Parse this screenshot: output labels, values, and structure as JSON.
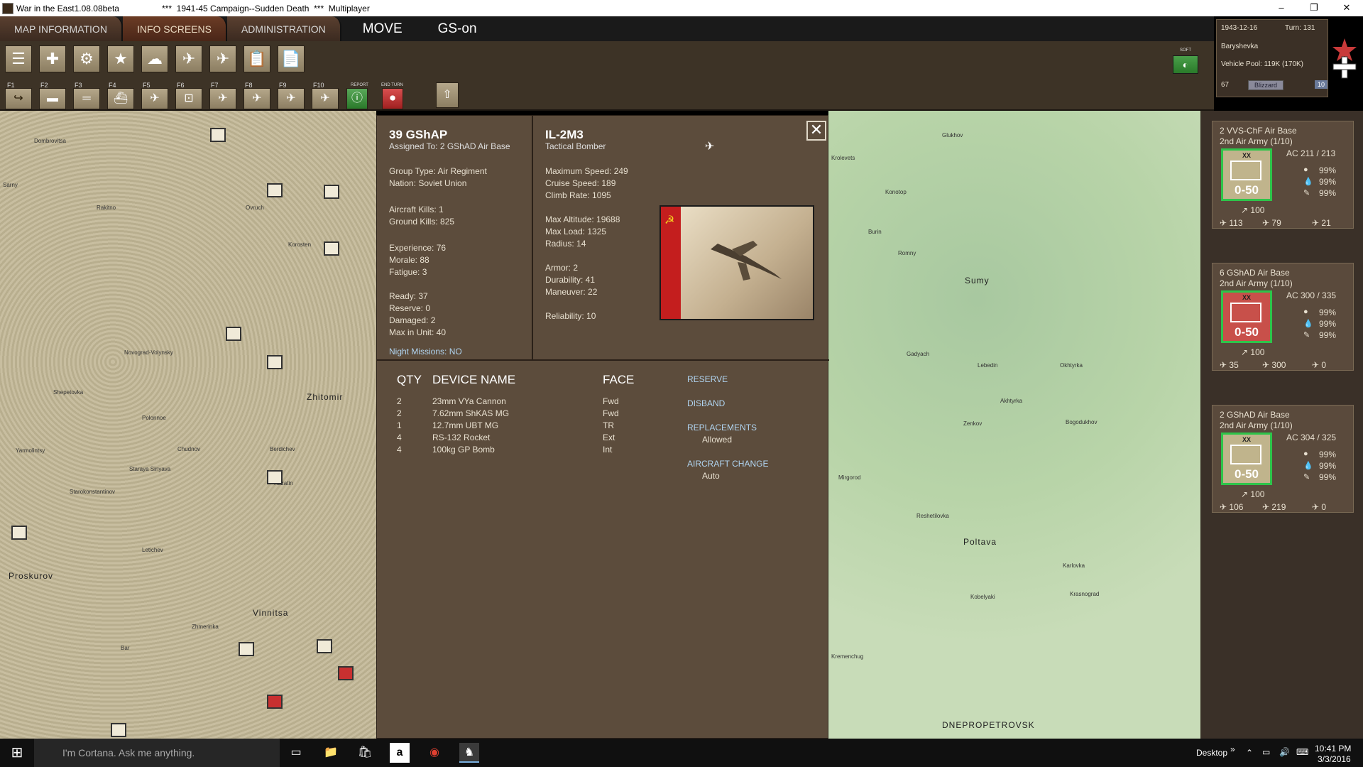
{
  "window": {
    "title_app": "War in the East1.08.08beta",
    "title_scenario": "***  1941-45 Campaign--Sudden Death  ***  Multiplayer",
    "min": "–",
    "max": "❐",
    "close": "✕"
  },
  "topbar": {
    "tabs": [
      "MAP INFORMATION",
      "INFO SCREENS",
      "ADMINISTRATION"
    ],
    "mode": "MOVE",
    "gs": "GS-on"
  },
  "toolbar": {
    "fkeys": [
      "F1",
      "F2",
      "F3",
      "F4",
      "F5",
      "F6",
      "F7",
      "F8",
      "F9",
      "F10"
    ],
    "report_label": "REPORT",
    "end_turn_label": "END TURN",
    "soft_label": "SOFT"
  },
  "info": {
    "date": "1943-12-16",
    "turn": "Turn: 131",
    "location": "Baryshevka",
    "vehicle_pool": "Vehicle Pool: 119K (170K)",
    "hex_value": "67",
    "weather": "Blizzard",
    "level": "10"
  },
  "unit": {
    "name": "39 GShAP",
    "assigned": "Assigned To: 2 GShAD Air Base",
    "group_type": "Group Type: Air Regiment",
    "nation": "Nation: Soviet Union",
    "aircraft_kills": "Aircraft Kills: 1",
    "ground_kills": "Ground Kills: 825",
    "experience": "Experience: 76",
    "morale": "Morale: 88",
    "fatigue": "Fatigue: 3",
    "ready": "Ready: 37",
    "reserve": "Reserve: 0",
    "damaged": "Damaged: 2",
    "max_in_unit": "Max in Unit:  40",
    "night_missions": "Night Missions: NO"
  },
  "aircraft": {
    "name": "IL-2M3",
    "type": "Tactical Bomber",
    "max_speed": "Maximum Speed: 249",
    "cruise_speed": "Cruise Speed: 189",
    "climb_rate": "Climb Rate: 1095",
    "max_altitude": "Max Altitude: 19688",
    "max_load": "Max Load: 1325",
    "radius": "Radius: 14",
    "armor": "Armor: 2",
    "durability": "Durability: 41",
    "maneuver": "Maneuver: 22",
    "reliability": "Reliability: 10"
  },
  "devices": {
    "headers": {
      "qty": "QTY",
      "name": "DEVICE NAME",
      "face": "FACE"
    },
    "rows": [
      {
        "qty": "2",
        "name": "23mm VYa Cannon",
        "face": "Fwd"
      },
      {
        "qty": "2",
        "name": "7.62mm ShKAS MG",
        "face": "Fwd"
      },
      {
        "qty": "1",
        "name": "12.7mm UBT MG",
        "face": "TR"
      },
      {
        "qty": "4",
        "name": "RS-132 Rocket",
        "face": "Ext"
      },
      {
        "qty": "4",
        "name": "100kg GP Bomb",
        "face": "Int"
      }
    ]
  },
  "actions": {
    "reserve": "RESERVE",
    "disband": "DISBAND",
    "replacements": "REPLACEMENTS",
    "replacements_value": "Allowed",
    "aircraft_change": "AIRCRAFT CHANGE",
    "aircraft_change_value": "Auto"
  },
  "bases": [
    {
      "name": "2 VVS-ChF Air Base",
      "army": "2nd Air Army (1/10)",
      "ac": "AC  211 / 213",
      "strength": "0-50",
      "xx": "XX",
      "p1": "99%",
      "p2": "99%",
      "p3": "99%",
      "move": "100",
      "b1": "113",
      "b2": "79",
      "b3": "21"
    },
    {
      "name": "6 GShAD Air Base",
      "army": "2nd Air Army (1/10)",
      "ac": "AC  300 / 335",
      "strength": "0-50",
      "xx": "XX",
      "p1": "99%",
      "p2": "99%",
      "p3": "99%",
      "move": "100",
      "b1": "35",
      "b2": "300",
      "b3": "0"
    },
    {
      "name": "2 GShAD Air Base",
      "army": "2nd Air Army (1/10)",
      "ac": "AC  304 / 325",
      "strength": "0-50",
      "xx": "XX",
      "p1": "99%",
      "p2": "99%",
      "p3": "99%",
      "move": "100",
      "b1": "106",
      "b2": "219",
      "b3": "0"
    }
  ],
  "map_labels": {
    "left": [
      "Dombrovitsa",
      "Rakitno",
      "Korosten",
      "Sarny",
      "Ovruch",
      "Novograd-Volynsky",
      "Zhitomir",
      "Chudnov",
      "Berdichev",
      "Yarmolintsy",
      "Staraya Sinyava",
      "Starokonstantinov",
      "Letichev",
      "Vinnitsa",
      "Proskurov",
      "Kazatin",
      "Shepetovka",
      "Polonnoe",
      "Bar",
      "Zhmerinka"
    ],
    "right": [
      "Krolevets",
      "Glukhov",
      "Konotop",
      "Burin",
      "Sumy",
      "Lebedin",
      "Poltava",
      "Mirgorod",
      "Romny",
      "Akhtyrka",
      "Krasnograd",
      "Kremenchug",
      "Karlovka",
      "Dnepropetrovsk",
      "Okhtyrka",
      "Bogodukhov",
      "Zenkov",
      "Gadyach",
      "Reshetilovka",
      "Kobelyaki"
    ],
    "city_big": "DNEPROPETROVSK"
  },
  "taskbar": {
    "search": "I'm Cortana. Ask me anything.",
    "desktop": "Desktop",
    "time": "10:41 PM",
    "date": "3/3/2016"
  },
  "colors": {
    "panel_bg": "#5c4c3c",
    "action_link": "#b0d4f0",
    "counter_green": "#2ec44a",
    "soviet_red": "#c41e1e"
  }
}
